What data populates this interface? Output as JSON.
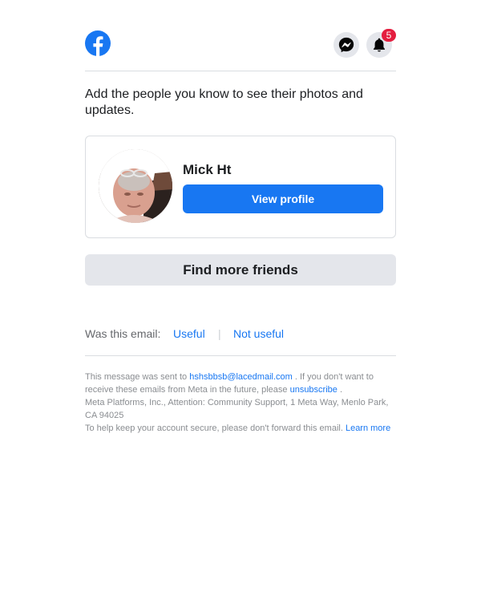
{
  "header": {
    "logo_icon": "facebook-logo-icon",
    "messenger_icon": "messenger-icon",
    "bell_icon": "bell-icon",
    "notification_count": "5"
  },
  "intro_text": "Add the people you know to see their photos and updates.",
  "suggestion": {
    "name": "Mick Ht",
    "view_profile_label": "View profile"
  },
  "find_more_label": "Find more friends",
  "feedback": {
    "question": "Was this email:",
    "useful": "Useful",
    "separator": "|",
    "not_useful": "Not useful"
  },
  "footer": {
    "sent_to_prefix": "This message was sent to",
    "email": "hshsbbsb@lacedmail.com",
    "receive_text": ". If you don't want to receive these emails from Meta in the future, please",
    "unsubscribe": "unsubscribe",
    "period": ".",
    "address": "Meta Platforms, Inc., Attention: Community Support, 1 Meta Way, Menlo Park, CA 94025",
    "secure_text": "To help keep your account secure, please don't forward this email.",
    "learn_more": "Learn more"
  },
  "colors": {
    "brand_blue": "#1877f2",
    "badge_red": "#e41e3f",
    "button_gray": "#e4e6eb"
  }
}
